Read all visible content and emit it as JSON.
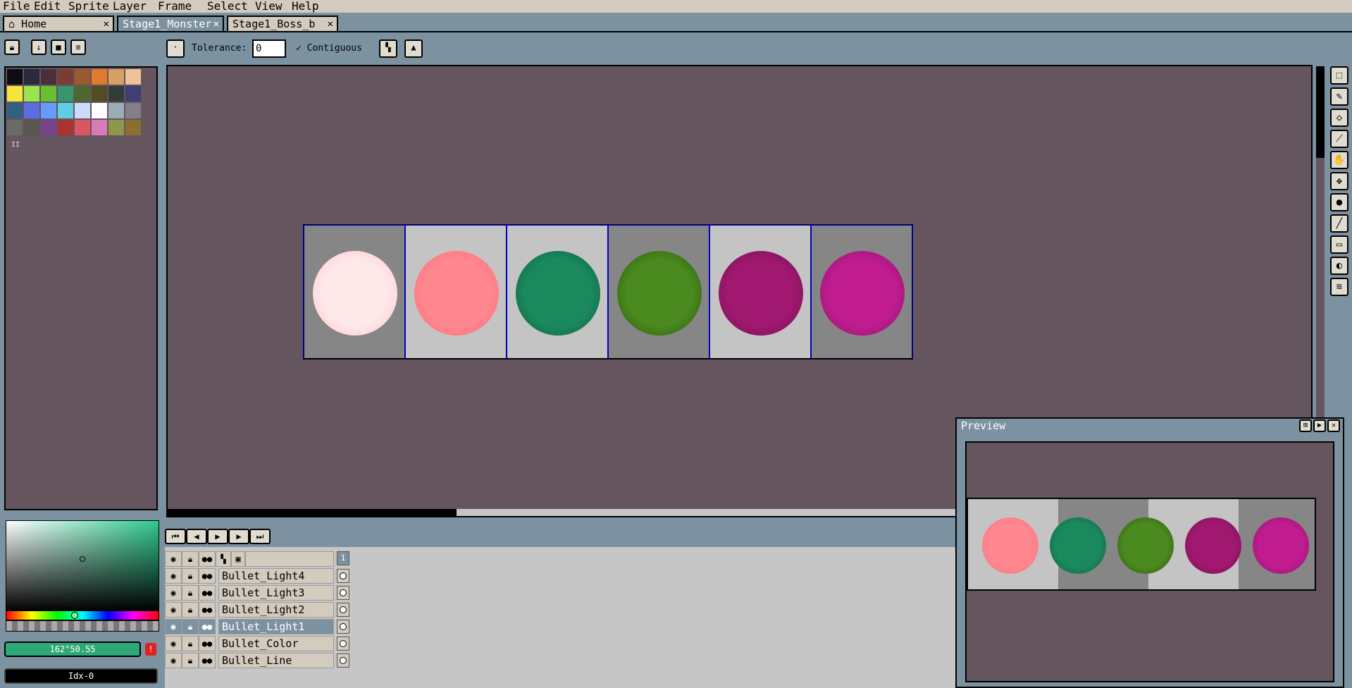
{
  "menu": [
    "File",
    "Edit",
    "Sprite",
    "Layer",
    "Frame",
    "Select",
    "View",
    "Help"
  ],
  "tabs": [
    {
      "label": "Home",
      "icon": "home-icon",
      "active": false
    },
    {
      "label": "Stage1_Monster",
      "active": true
    },
    {
      "label": "Stage1_Boss_b",
      "active": false
    }
  ],
  "toolbar": {
    "tolerance_label": "Tolerance:",
    "tolerance_value": "0",
    "contiguous_label": "Contiguous",
    "contiguous_checked": true
  },
  "palette": {
    "colors": [
      "#0d0d12",
      "#2a2a3d",
      "#4a2f3b",
      "#7a3d36",
      "#9a5a2e",
      "#e07a2c",
      "#d9a066",
      "#eec39a",
      "#f6e53c",
      "#99e550",
      "#6abe30",
      "#37946e",
      "#4b692f",
      "#524b24",
      "#323c39",
      "#3f3f74",
      "#306082",
      "#5b6ee1",
      "#639bff",
      "#5fcde4",
      "#cbdbfc",
      "#ffffff",
      "#9badb7",
      "#847e87",
      "#696a6a",
      "#595652",
      "#76428a",
      "#ac3232",
      "#d95763",
      "#d77bba",
      "#8f974a",
      "#8a6f30"
    ],
    "index_marker": "II"
  },
  "color_picker": {
    "value_text": "162°50.55",
    "index_text": "Idx-0",
    "accent": "#2fa879"
  },
  "sprite": {
    "frames": [
      {
        "bg": "#868686",
        "gem_color": "#ffe8ea",
        "gem_edge": "#ffc0c8"
      },
      {
        "bg": "#c4c4c4",
        "gem_color": "#ff8890",
        "gem_edge": "#ff6c78"
      },
      {
        "bg": "#c4c4c4",
        "gem_color": "#1a8a5e",
        "gem_edge": "#0f5a3c"
      },
      {
        "bg": "#868686",
        "gem_color": "#4a8a1e",
        "gem_edge": "#2a5510"
      },
      {
        "bg": "#c4c4c4",
        "gem_color": "#a01870",
        "gem_edge": "#70104e"
      },
      {
        "bg": "#868686",
        "gem_color": "#c01c90",
        "gem_edge": "#8a1466"
      }
    ]
  },
  "timeline": {
    "frame_number": "1",
    "layers": [
      {
        "name": "Bullet_Light4",
        "selected": false
      },
      {
        "name": "Bullet_Light3",
        "selected": false
      },
      {
        "name": "Bullet_Light2",
        "selected": false
      },
      {
        "name": "Bullet_Light1",
        "selected": true
      },
      {
        "name": "Bullet_Color",
        "selected": false
      },
      {
        "name": "Bullet_Line",
        "selected": false
      }
    ]
  },
  "preview": {
    "title": "Preview"
  },
  "tools": [
    "marquee-icon",
    "pencil-icon",
    "eraser-icon",
    "eyedropper-icon",
    "hand-icon",
    "move-icon",
    "paint-bucket-icon",
    "line-icon",
    "rectangle-icon",
    "ellipse-icon",
    "spray-icon"
  ]
}
